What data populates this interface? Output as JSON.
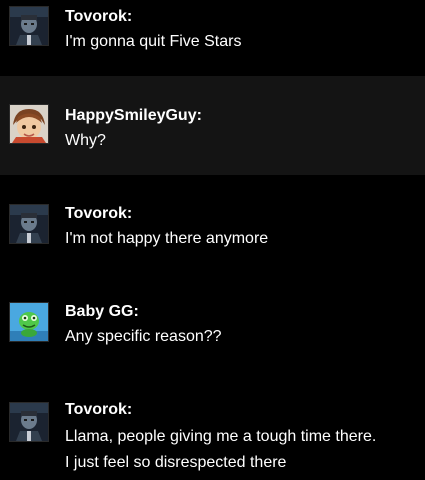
{
  "messages": [
    {
      "author": "Tovorok:",
      "avatar": "tovorok-avatar",
      "lines": [
        "I'm gonna quit Five Stars"
      ]
    },
    {
      "author": "HappySmileyGuy:",
      "avatar": "happysmileyguy-avatar",
      "lines": [
        "Why?"
      ]
    },
    {
      "author": "Tovorok:",
      "avatar": "tovorok-avatar",
      "lines": [
        "I'm not happy there anymore"
      ]
    },
    {
      "author": "Baby GG:",
      "avatar": "baby-gg-avatar",
      "lines": [
        "Any specific reason??"
      ]
    },
    {
      "author": "Tovorok:",
      "avatar": "tovorok-avatar",
      "lines": [
        "Llama, people giving me a tough time there.",
        "I just feel so disrespected there"
      ]
    }
  ],
  "colors": {
    "background": "#000000",
    "alt_row_background": "#141414",
    "text": "#ffffff"
  }
}
